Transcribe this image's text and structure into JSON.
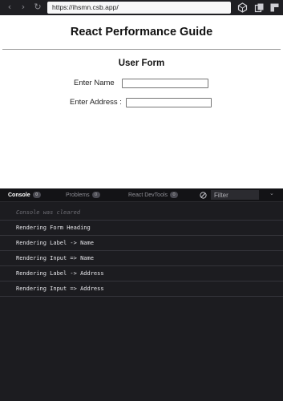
{
  "browser": {
    "url": "https://ihsmn.csb.app/",
    "back_icon": "chevron-left-icon",
    "forward_icon": "chevron-right-icon",
    "reload_icon": "reload-icon"
  },
  "page": {
    "title": "React Performance Guide",
    "form": {
      "heading": "User Form",
      "name_label": "Enter Name",
      "name_value": "",
      "address_label": "Enter Address :",
      "address_value": ""
    }
  },
  "devtools": {
    "tabs": [
      {
        "label": "Console",
        "count": "0",
        "active": true
      },
      {
        "label": "Problems",
        "count": "0",
        "active": false
      },
      {
        "label": "React DevTools",
        "count": "0",
        "active": false
      }
    ],
    "filter_placeholder": "Filter",
    "console_lines": [
      "Console was cleared",
      "Rendering Form Heading",
      "Rendering Label -> Name",
      "Rendering Input => Name",
      "Rendering Label -> Address",
      "Rendering Input => Address"
    ]
  },
  "colors": {
    "devtools_bg": "#1c1c20",
    "page_bg": "#ffffff",
    "console_text": "#e6e6ea"
  }
}
